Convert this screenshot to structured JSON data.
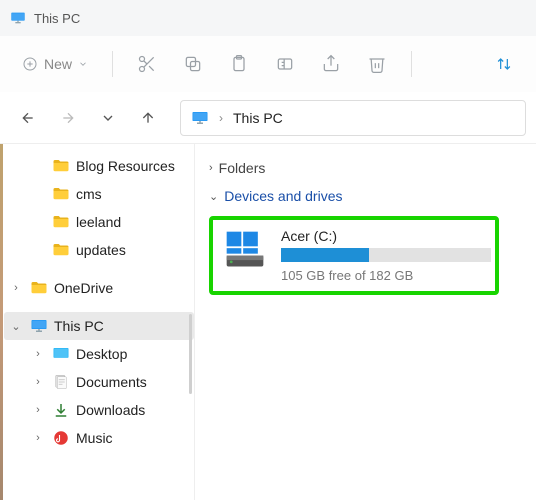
{
  "window": {
    "title": "This PC"
  },
  "toolbar": {
    "new_label": "New"
  },
  "address": {
    "location": "This PC"
  },
  "sidebar": {
    "items": [
      {
        "label": "Blog Resources"
      },
      {
        "label": "cms"
      },
      {
        "label": "leeland"
      },
      {
        "label": "updates"
      },
      {
        "label": "OneDrive"
      },
      {
        "label": "This PC"
      },
      {
        "label": "Desktop"
      },
      {
        "label": "Documents"
      },
      {
        "label": "Downloads"
      },
      {
        "label": "Music"
      }
    ]
  },
  "content": {
    "folders_header": "Folders",
    "devices_header": "Devices and drives",
    "drive": {
      "name": "Acer (C:)",
      "free_text": "105 GB free of 182 GB",
      "used_percent": 42
    }
  }
}
